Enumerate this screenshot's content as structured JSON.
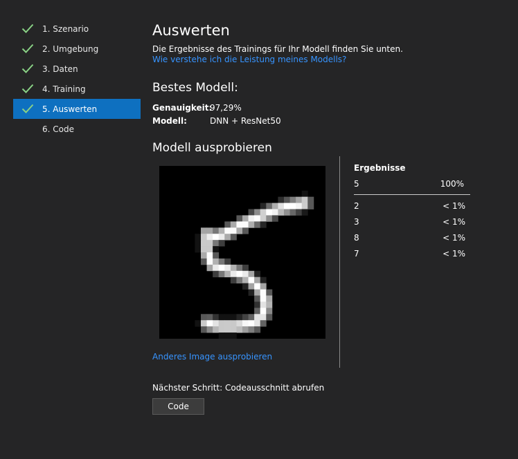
{
  "sidebar": {
    "steps": [
      {
        "label": "1. Szenario",
        "done": true
      },
      {
        "label": "2. Umgebung",
        "done": true
      },
      {
        "label": "3. Daten",
        "done": true
      },
      {
        "label": "4. Training",
        "done": true
      },
      {
        "label": "5. Auswerten",
        "done": true,
        "active": true
      },
      {
        "label": "6. Code",
        "done": false
      }
    ]
  },
  "main": {
    "title": "Auswerten",
    "intro": "Die Ergebnisse des Trainings für Ihr Modell finden Sie unten.",
    "help_link": "Wie verstehe ich die Leistung meines Modells?",
    "best_model": {
      "title": "Bestes Modell:",
      "accuracy_label": "Genauigkeit:",
      "accuracy_value": "97,29%",
      "model_label": "Modell:",
      "model_value": "DNN + ResNet50"
    },
    "try_model": {
      "title": "Modell ausprobieren",
      "try_other_link": "Anderes Image ausprobieren",
      "image_subject": "handwritten digit 5"
    },
    "results": {
      "header": "Ergebnisse",
      "top": {
        "label": "5",
        "value": "100%"
      },
      "rest": [
        {
          "label": "2",
          "value": "< 1%"
        },
        {
          "label": "3",
          "value": "< 1%"
        },
        {
          "label": "8",
          "value": "< 1%"
        },
        {
          "label": "7",
          "value": "< 1%"
        }
      ]
    },
    "next_step_text": "Nächster Schritt: Codeausschnitt abrufen",
    "code_button": "Code"
  },
  "colors": {
    "background": "#252526",
    "active_step": "#0e70c0",
    "link": "#3794ff",
    "check": "#89d185"
  }
}
